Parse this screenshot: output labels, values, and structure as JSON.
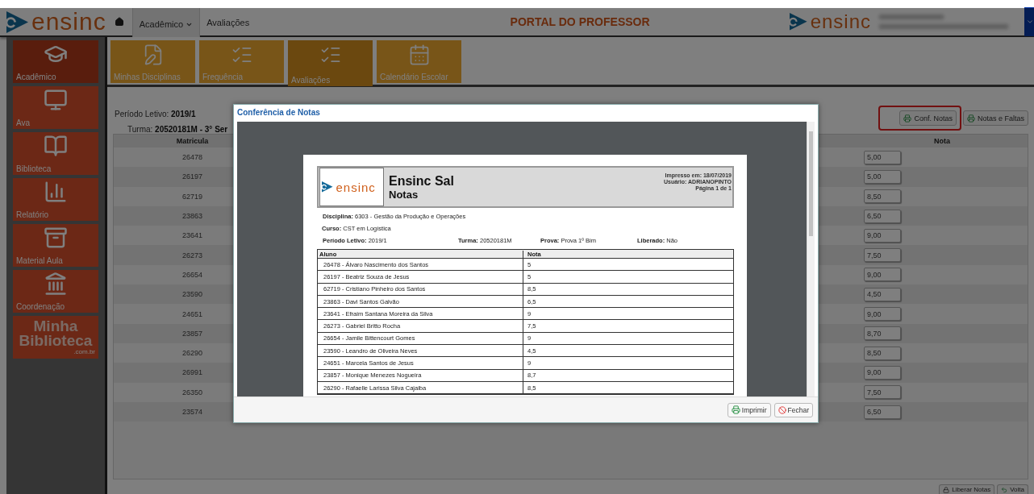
{
  "header": {
    "logo": "ensinc",
    "nav": [
      {
        "kind": "dropdown",
        "label": "Acadêmico",
        "selected": true
      },
      {
        "kind": "link",
        "label": "Avaliações",
        "selected": false
      }
    ],
    "title": "PORTAL DO PROFESSOR",
    "logo_right": "ensinc"
  },
  "sidebar": {
    "items": [
      {
        "kind": "icon",
        "label": "Acadêmico",
        "selected": true
      },
      {
        "kind": "icon",
        "label": "Ava",
        "selected": false
      },
      {
        "kind": "icon",
        "label": "Biblioteca",
        "selected": false
      },
      {
        "kind": "icon",
        "label": "Relatório",
        "selected": false
      },
      {
        "kind": "icon",
        "label": "Material Aula",
        "selected": false
      },
      {
        "kind": "icon",
        "label": "Coordenação",
        "selected": false
      },
      {
        "kind": "brand",
        "label": "Minha Biblioteca",
        "suffix": ".com.br",
        "selected": false
      }
    ]
  },
  "modules": [
    {
      "label": "Minhas Disciplinas",
      "selected": false
    },
    {
      "label": "Frequência",
      "selected": false
    },
    {
      "label": "Avaliações",
      "selected": true
    },
    {
      "label": "Calendário Escolar",
      "selected": false
    }
  ],
  "info": {
    "period_label": "Período Letivo:",
    "period": "2019/1",
    "class_label": "Turma:",
    "class": "20520181M - 3° Ser"
  },
  "toolbar": [
    {
      "label": "Conf. Notas",
      "highlighted": true
    },
    {
      "label": "Notas e Faltas",
      "highlighted": false
    }
  ],
  "table": {
    "columns": [
      "Matricula",
      "Nota"
    ],
    "rows": [
      {
        "id": "26478",
        "grade": "5,00"
      },
      {
        "id": "26197",
        "grade": "5,00"
      },
      {
        "id": "62719",
        "grade": "8,50"
      },
      {
        "id": "23863",
        "grade": "6,50"
      },
      {
        "id": "23641",
        "grade": "9,00"
      },
      {
        "id": "26273",
        "grade": "7,50"
      },
      {
        "id": "26654",
        "grade": "9,00"
      },
      {
        "id": "23590",
        "grade": "4,50"
      },
      {
        "id": "24651",
        "grade": "9,00"
      },
      {
        "id": "23857",
        "grade": "8,70"
      },
      {
        "id": "26290",
        "grade": "8,50"
      },
      {
        "id": "26991",
        "grade": "9,00"
      },
      {
        "id": "26350",
        "grade": "7,50"
      },
      {
        "id": "23574",
        "grade": "6,50"
      }
    ]
  },
  "bottom_buttons": [
    {
      "kind": "lock",
      "label": "Liberar Notas"
    },
    {
      "kind": "back",
      "label": "Volta"
    }
  ],
  "dialog": {
    "title": "Conferência de Notas",
    "report": {
      "logo": "ensinc",
      "company": "Ensinc Sal",
      "title": "Notas",
      "meta": [
        "Impresso em: 18/07/2019",
        "Usuário: ADRIANOPINTO",
        "Página 1 de 1"
      ],
      "discipline_label": "Disciplina:",
      "discipline": "6303 - Gestão da Produção e Operações",
      "course_label": "Curso:",
      "course": "CST em Logística",
      "fields": [
        {
          "label": "Período Letivo:",
          "value": "2019/1"
        },
        {
          "label": "Turma:",
          "value": "20520181M"
        },
        {
          "label": "Prova:",
          "value": "Prova 1º Bim"
        },
        {
          "label": "Liberado:",
          "value": "Não"
        }
      ],
      "columns": [
        "Aluno",
        "Nota"
      ],
      "rows": [
        [
          "26478 - Álvaro Nascimento dos Santos",
          "5"
        ],
        [
          "26197 - Beatriz Souza de Jesus",
          "5"
        ],
        [
          "62719 - Cristiano Pinheiro dos Santos",
          "8,5"
        ],
        [
          "23863 - Davi Santos Galvão",
          "6,5"
        ],
        [
          "23641 - Efraim Santana Moreira da Silva",
          "9"
        ],
        [
          "26273 - Gabriel Britto Rocha",
          "7,5"
        ],
        [
          "26654 - Jamile Bittencourt Gomes",
          "9"
        ],
        [
          "23590 - Leandro de Oliveira Neves",
          "4,5"
        ],
        [
          "24651 - Marcela Santos de Jesus",
          "9"
        ],
        [
          "23857 - Monique Menezes Nogueira",
          "8,7"
        ],
        [
          "26290 - Rafaelle Larissa Silva Cajaiba",
          "8,5"
        ]
      ]
    },
    "buttons": [
      {
        "kind": "print",
        "label": "Imprimir"
      },
      {
        "kind": "close",
        "label": "Fechar"
      }
    ]
  }
}
